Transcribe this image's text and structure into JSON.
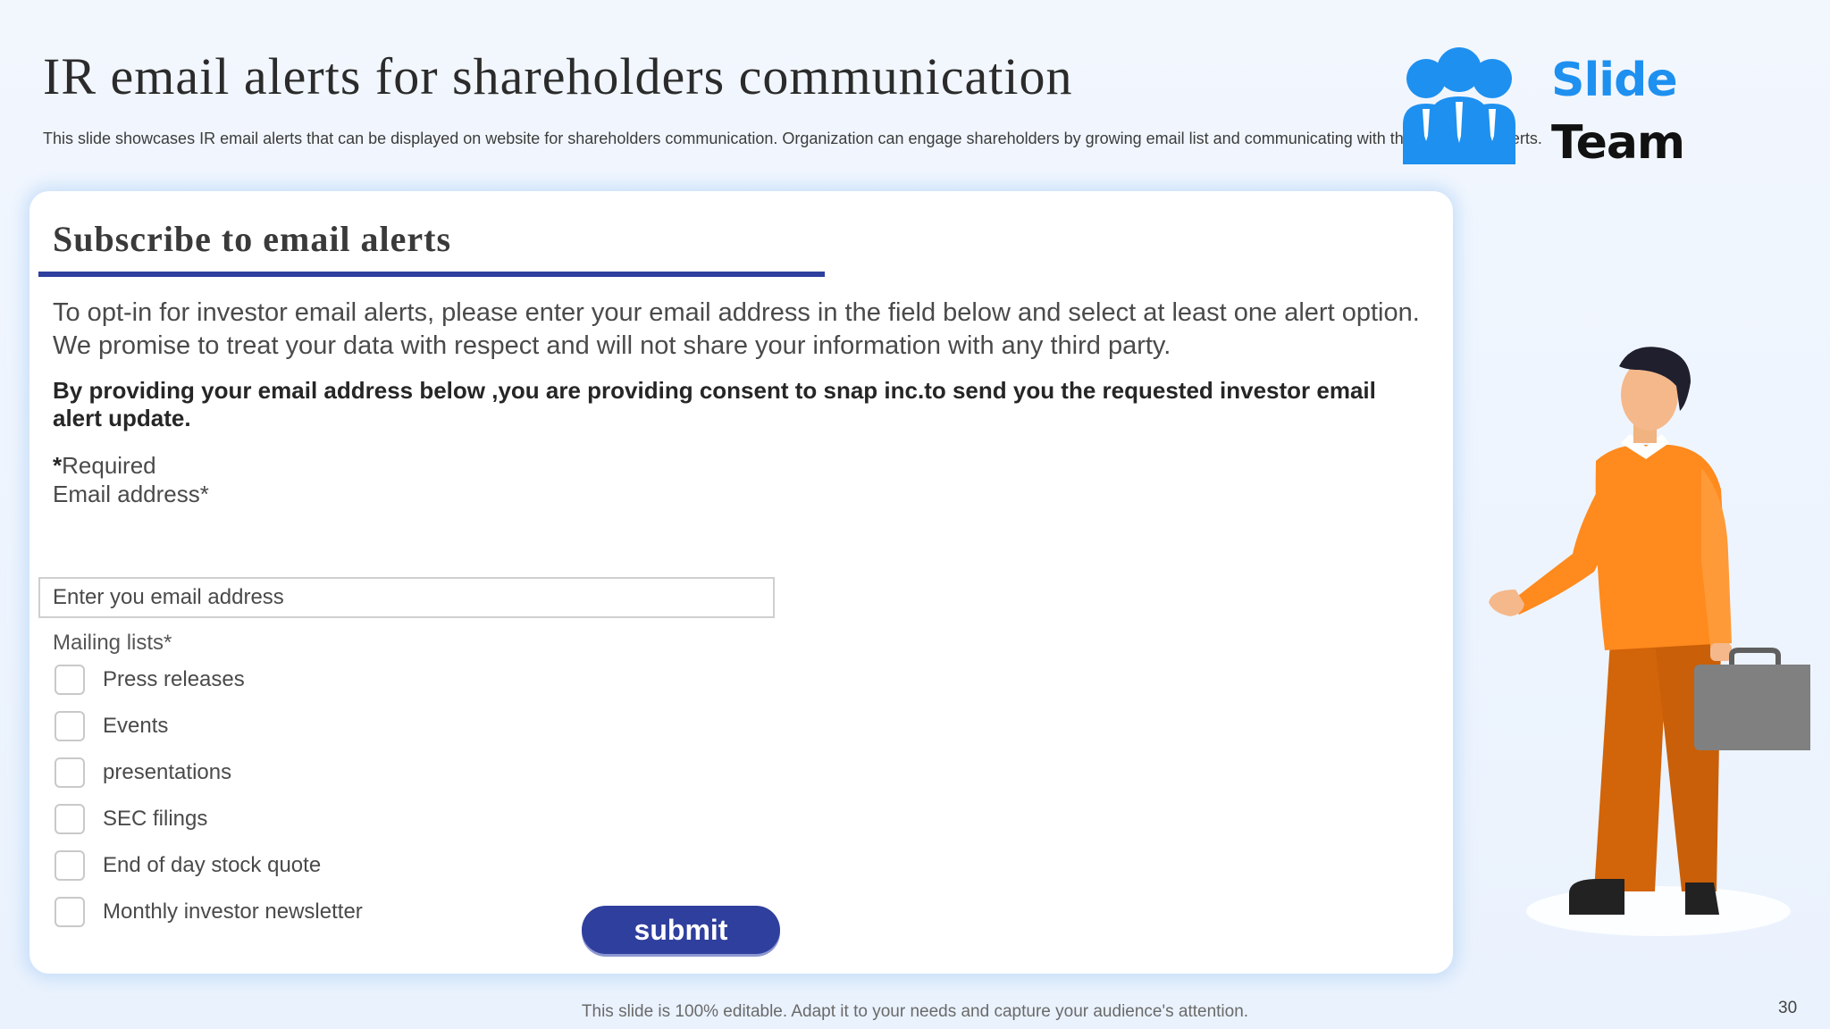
{
  "slide": {
    "title": "IR email alerts for shareholders communication",
    "subtitle": "This slide showcases IR email alerts that can be displayed on website for shareholders communication. Organization can engage shareholders by growing email list and communicating with them via email alerts."
  },
  "logo": {
    "line1": "Slide",
    "line2": "Team",
    "icon": "people-group-icon",
    "colors": {
      "primary": "#1e90f0",
      "text": "#111111"
    }
  },
  "form": {
    "heading": "Subscribe to email alerts",
    "intro": "To opt-in for investor email alerts, please enter your email address in the field below and select at least one alert option. We promise to treat your data with respect and will not share your information with any third party.",
    "consent": "By providing your email address below ,you are providing consent to snap inc.to send you the requested investor email alert update.",
    "required_star": "*",
    "required_text": "Required",
    "email_label": "Email address*",
    "email_placeholder": "Enter you email address",
    "email_value": "",
    "mailing_label": "Mailing  lists*",
    "options": [
      {
        "label": "Press releases",
        "checked": false
      },
      {
        "label": "Events",
        "checked": false
      },
      {
        "label": "presentations",
        "checked": false
      },
      {
        "label": "SEC filings",
        "checked": false
      },
      {
        "label": "End of day stock quote",
        "checked": false
      },
      {
        "label": "Monthly  investor newsletter",
        "checked": false
      }
    ],
    "submit_label": "submit"
  },
  "illustration": {
    "icon": "businessman-with-briefcase-illustration"
  },
  "footer": {
    "text": "This slide is 100% editable. Adapt it to your needs and capture your audience's attention.",
    "page_number": "30"
  },
  "colors": {
    "accent": "#2f3f9e",
    "background": "#eef4fd",
    "shirt": "#ff8a1e",
    "pants": "#d2640a",
    "briefcase": "#808080"
  }
}
